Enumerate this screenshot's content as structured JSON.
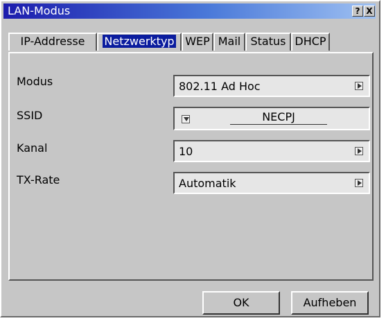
{
  "window": {
    "title": "LAN-Modus",
    "help_label": "?",
    "close_label": "X"
  },
  "tabs": [
    {
      "label": "IP-Addresse",
      "active": false
    },
    {
      "label": "Netzwerktyp",
      "active": true
    },
    {
      "label": "WEP",
      "active": false
    },
    {
      "label": "Mail",
      "active": false
    },
    {
      "label": "Status",
      "active": false
    },
    {
      "label": "DHCP",
      "active": false
    }
  ],
  "form": {
    "modus": {
      "label": "Modus",
      "value": "802.11 Ad Hoc"
    },
    "ssid": {
      "label": "SSID",
      "value": "NECPJ"
    },
    "kanal": {
      "label": "Kanal",
      "value": "10"
    },
    "txrate": {
      "label": "TX-Rate",
      "value": "Automatik"
    }
  },
  "buttons": {
    "ok": "OK",
    "cancel": "Aufheben"
  }
}
